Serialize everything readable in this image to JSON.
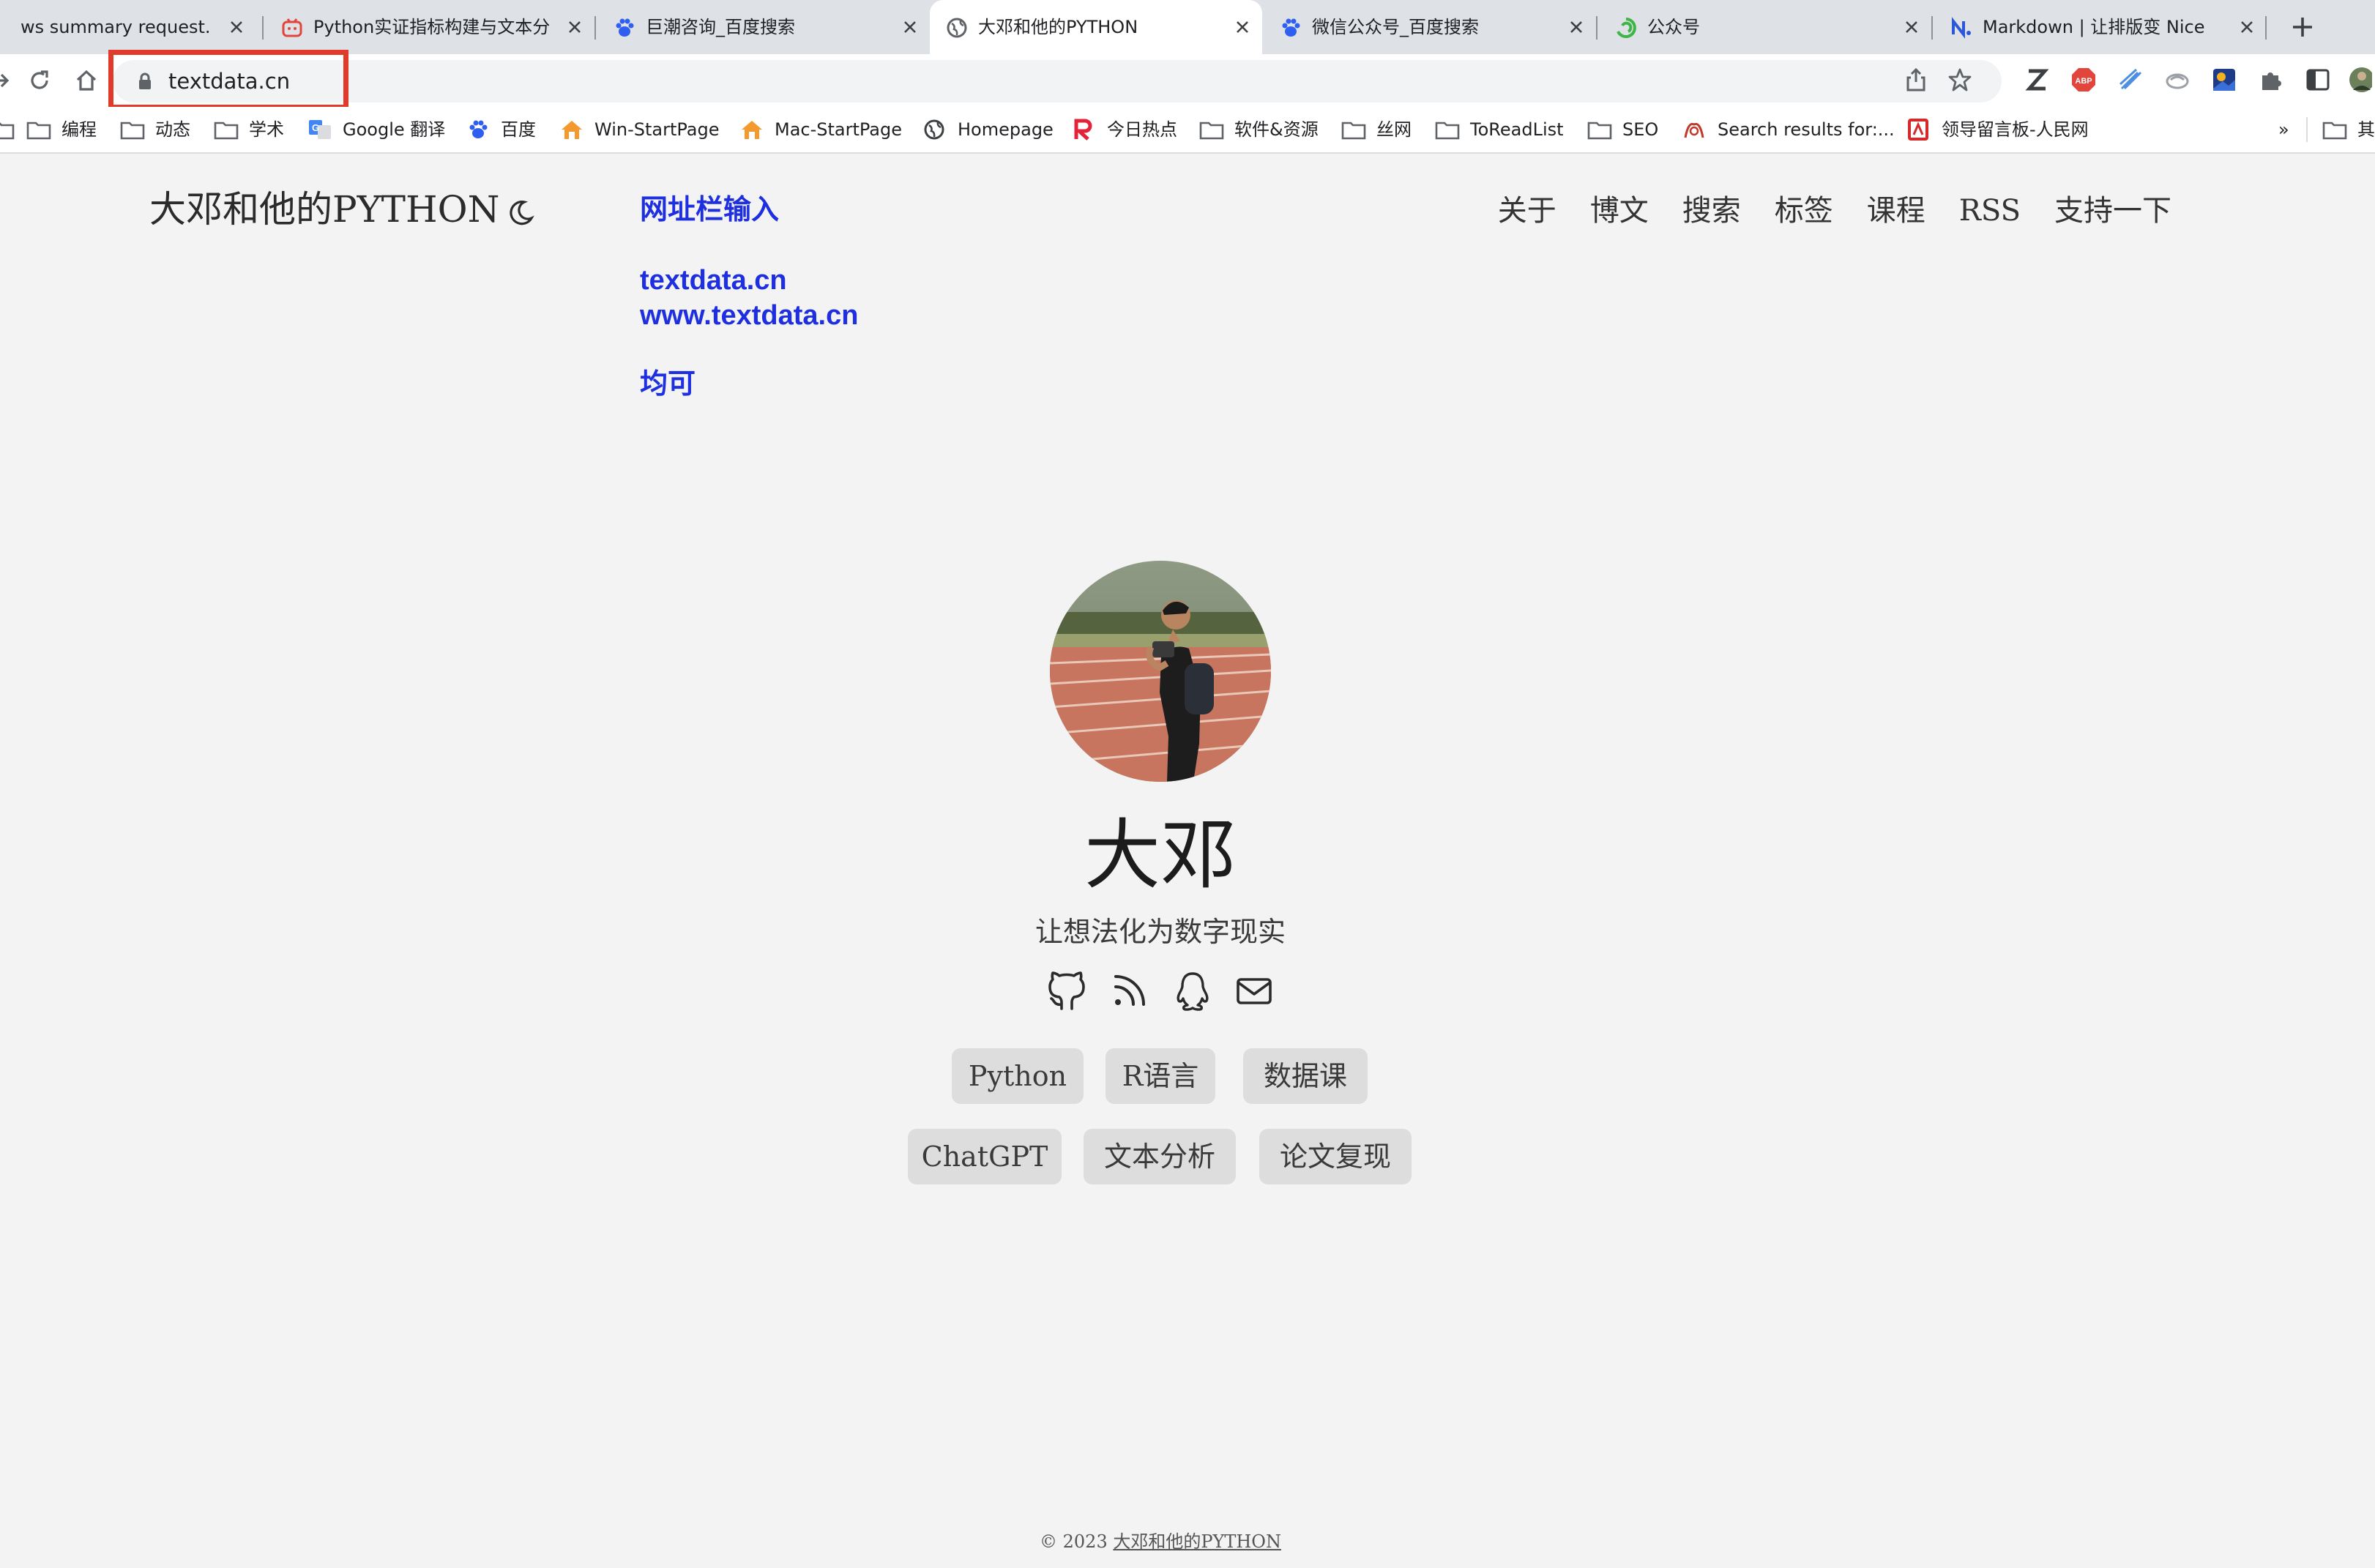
{
  "tabs": [
    {
      "title": "ws summary request.",
      "active": false
    },
    {
      "title": "Python实证指标构建与文本分析",
      "active": false
    },
    {
      "title": "巨潮咨询_百度搜索",
      "active": false
    },
    {
      "title": "大邓和他的PYTHON",
      "active": true
    },
    {
      "title": "微信公众号_百度搜索",
      "active": false
    },
    {
      "title": "公众号",
      "active": false
    },
    {
      "title": "Markdown | 让排版变 Nice",
      "active": false
    }
  ],
  "address_bar": {
    "url": "textdata.cn"
  },
  "bookmarks": [
    {
      "label": "编程",
      "icon": "folder-icon"
    },
    {
      "label": "动态",
      "icon": "folder-icon"
    },
    {
      "label": "学术",
      "icon": "folder-icon"
    },
    {
      "label": "Google 翻译",
      "icon": "google-translate-icon"
    },
    {
      "label": "百度",
      "icon": "baidu-icon"
    },
    {
      "label": "Win-StartPage",
      "icon": "home-icon"
    },
    {
      "label": "Mac-StartPage",
      "icon": "home-icon"
    },
    {
      "label": "Homepage",
      "icon": "globe-icon"
    },
    {
      "label": "今日热点",
      "icon": "r-logo-icon"
    },
    {
      "label": "软件&资源",
      "icon": "folder-icon"
    },
    {
      "label": "丝网",
      "icon": "folder-icon"
    },
    {
      "label": "ToReadList",
      "icon": "folder-icon"
    },
    {
      "label": "SEO",
      "icon": "folder-icon"
    },
    {
      "label": "Search results for:...",
      "icon": "search-results-icon"
    },
    {
      "label": "领导留言板-人民网",
      "icon": "people-daily-icon"
    },
    {
      "label": "»",
      "icon": "chevron-icon"
    },
    {
      "label": "其",
      "icon": "folder-icon"
    }
  ],
  "site": {
    "title": "大邓和他的PYTHON",
    "nav": [
      "关于",
      "博文",
      "搜索",
      "标签",
      "课程",
      "RSS",
      "支持一下"
    ]
  },
  "annotation": {
    "heading": "网址栏输入",
    "line1": "textdata.cn",
    "line2": "www.textdata.cn",
    "line3": "均可",
    "highlight_color": "#e23a2a",
    "text_color": "#1e2fe0"
  },
  "profile": {
    "name": "大邓",
    "tagline": "让想法化为数字现实",
    "social_icons": [
      "github-icon",
      "rss-icon",
      "qq-icon",
      "mail-icon"
    ],
    "tags": [
      "Python",
      "R语言",
      "数据课",
      "ChatGPT",
      "文本分析",
      "论文复现"
    ]
  },
  "footer": {
    "copyright": "© 2023",
    "link": "大邓和他的PYTHON"
  }
}
